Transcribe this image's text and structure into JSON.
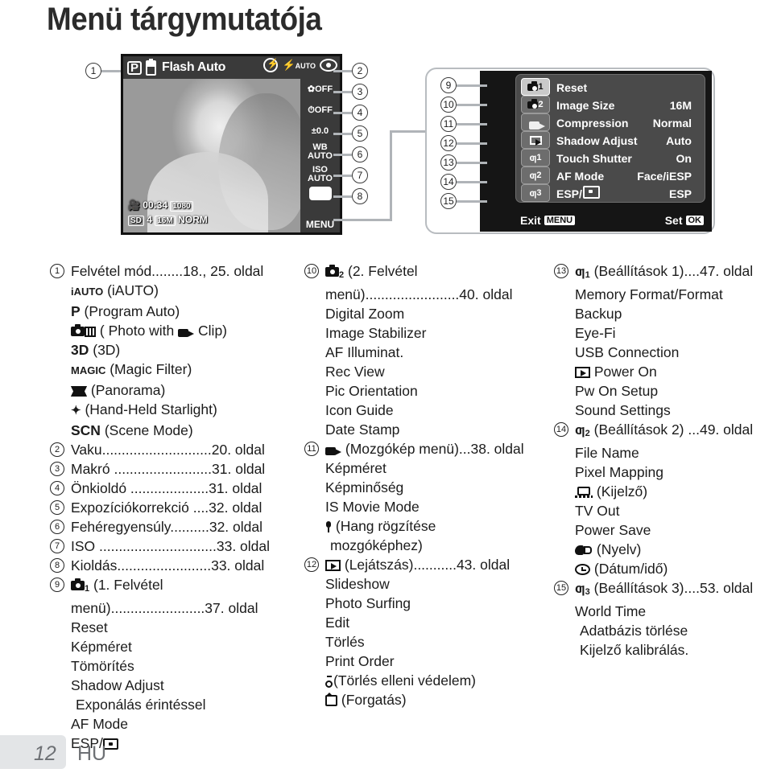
{
  "page": {
    "title": "Menü tárgymutatója",
    "number": "12",
    "language_code": "HU"
  },
  "lcd": {
    "mode_badge": "P",
    "battery_icon": "battery-icon",
    "top_title": "Flash Auto",
    "top_icons": [
      "flash-off-icon",
      "flash-auto-icon",
      "red-eye-icon"
    ],
    "strip": [
      {
        "label": "OFF",
        "icon": "macro-icon"
      },
      {
        "label": "OFF",
        "icon": "self-timer-icon"
      },
      {
        "label": "±0.0",
        "icon": "exposure-comp-icon"
      },
      {
        "label": "WB\nAUTO",
        "icon": "white-balance-icon"
      },
      {
        "label": "ISO\nAUTO",
        "icon": "iso-icon"
      },
      {
        "label": "",
        "icon": "drive-mode-icon"
      }
    ],
    "strip_wb_line1": "WB",
    "strip_wb_line2": "AUTO",
    "strip_iso_line1": "ISO",
    "strip_iso_line2": "AUTO",
    "strip_exp": "±0.0",
    "strip_macro_off": "OFF",
    "strip_timer_off": "OFF",
    "menu_button_label": "MENU",
    "status": {
      "movie_time": "00:34",
      "movie_res": "1080",
      "card": "SD",
      "shots": "4",
      "image_size": "16M",
      "quality": "NORM"
    }
  },
  "menu_screen": {
    "tabs": [
      "■₁",
      "■₂",
      "■",
      "▶",
      "ƒ₁",
      "ƒ₂",
      "ƒ₃"
    ],
    "tab_names": [
      "shooting-menu-1-tab",
      "shooting-menu-2-tab",
      "movie-menu-tab",
      "playback-menu-tab",
      "settings-1-tab",
      "settings-2-tab",
      "settings-3-tab"
    ],
    "rows": [
      {
        "label": "Reset",
        "value": ""
      },
      {
        "label": "Image Size",
        "value": "16M"
      },
      {
        "label": "Compression",
        "value": "Normal"
      },
      {
        "label": "Shadow Adjust",
        "value": "Auto"
      },
      {
        "label": "Touch Shutter",
        "value": "On"
      },
      {
        "label": "AF Mode",
        "value": "Face/iESP"
      },
      {
        "label": "ESP/",
        "value": "ESP",
        "has_spot_icon": true
      }
    ],
    "footer_exit": "Exit",
    "footer_exit_key": "MENU",
    "footer_set": "Set",
    "footer_set_key": "OK"
  },
  "callouts": {
    "left": [
      "1",
      "2",
      "3",
      "4",
      "5",
      "6",
      "7",
      "8"
    ],
    "right": [
      "9",
      "10",
      "11",
      "12",
      "13",
      "14",
      "15"
    ]
  },
  "columns": {
    "col1": [
      {
        "type": "entry",
        "num": "1",
        "text": "Felvétel mód........18., 25. oldal"
      },
      {
        "type": "sub",
        "bold_prefix": "iAUTO",
        "text": " (iAUTO)"
      },
      {
        "type": "sub",
        "bold_prefix": "P",
        "text": " (Program Auto)"
      },
      {
        "type": "sub_icon",
        "icon": "photo-with-clip-icon",
        "text": "( Photo with",
        "text2": "Clip)"
      },
      {
        "type": "sub",
        "bold_prefix": "3D",
        "text": " (3D)"
      },
      {
        "type": "sub",
        "bold_prefix": "MAGIC",
        "text": " (Magic Filter)"
      },
      {
        "type": "sub_icon",
        "icon": "panorama-icon",
        "text": "(Panorama)"
      },
      {
        "type": "sub_icon",
        "icon": "hand-held-starlight-icon",
        "text": "(Hand-Held Starlight)"
      },
      {
        "type": "sub",
        "bold_prefix": "SCN",
        "text": " (Scene Mode)"
      },
      {
        "type": "entry",
        "num": "2",
        "text": "Vaku............................20. oldal"
      },
      {
        "type": "entry",
        "num": "3",
        "text": "Makró .........................31. oldal"
      },
      {
        "type": "entry",
        "num": "4",
        "text": "Önkioldó ....................31. oldal"
      },
      {
        "type": "entry",
        "num": "5",
        "text": "Expozíciókorrekció ....32. oldal"
      },
      {
        "type": "entry",
        "num": "6",
        "text": "Fehéregyensúly..........32. oldal"
      },
      {
        "type": "entry",
        "num": "7",
        "text": "ISO ..............................33. oldal"
      },
      {
        "type": "entry",
        "num": "8",
        "text": "Kioldás........................33. oldal"
      },
      {
        "type": "entry_icon",
        "num": "9",
        "icon": "shooting-menu-1-icon",
        "text": "(1. Felvétel"
      },
      {
        "type": "cont",
        "text": "menü)........................37. oldal"
      },
      {
        "type": "cont",
        "text": "Reset"
      },
      {
        "type": "cont",
        "text": "Képméret"
      },
      {
        "type": "cont",
        "text": "Tömörítés"
      },
      {
        "type": "cont",
        "text": "Shadow Adjust"
      },
      {
        "type": "cont_indent",
        "text": "Exponálás érintéssel"
      },
      {
        "type": "cont",
        "text": "AF Mode"
      },
      {
        "type": "cont_esp",
        "text": "ESP/"
      }
    ],
    "col2": [
      {
        "type": "entry_icon",
        "num": "10",
        "icon": "shooting-menu-2-icon",
        "text": "(2. Felvétel"
      },
      {
        "type": "cont",
        "text": "menü)........................40. oldal"
      },
      {
        "type": "cont",
        "text": "Digital Zoom"
      },
      {
        "type": "cont",
        "text": "Image Stabilizer"
      },
      {
        "type": "cont",
        "text": "AF Illuminat."
      },
      {
        "type": "cont",
        "text": "Rec View"
      },
      {
        "type": "cont",
        "text": "Pic Orientation"
      },
      {
        "type": "cont",
        "text": "Icon Guide"
      },
      {
        "type": "cont",
        "text": "Date Stamp"
      },
      {
        "type": "entry_icon",
        "num": "11",
        "icon": "movie-menu-icon",
        "text": "(Mozgókép menü)...38. oldal"
      },
      {
        "type": "cont",
        "text": "Képméret"
      },
      {
        "type": "cont",
        "text": "Képminőség"
      },
      {
        "type": "cont",
        "text": "IS Movie Mode"
      },
      {
        "type": "cont_icon",
        "icon": "microphone-icon",
        "text": "(Hang rögzítése"
      },
      {
        "type": "cont_indent",
        "text": "mozgóképhez)"
      },
      {
        "type": "entry_icon",
        "num": "12",
        "icon": "playback-icon",
        "text": "(Lejátszás)...........43. oldal"
      },
      {
        "type": "cont",
        "text": "Slideshow"
      },
      {
        "type": "cont",
        "text": "Photo Surfing"
      },
      {
        "type": "cont",
        "text": "Edit"
      },
      {
        "type": "cont",
        "text": "Törlés"
      },
      {
        "type": "cont",
        "text": "Print Order"
      },
      {
        "type": "cont_icon",
        "icon": "protect-icon",
        "text": "(Törlés elleni védelem)"
      },
      {
        "type": "cont_icon",
        "icon": "rotate-icon",
        "text": "(Forgatás)"
      }
    ],
    "col3": [
      {
        "type": "entry_icon",
        "num": "13",
        "icon": "settings-1-icon",
        "text": "(Beállítások 1)....47. oldal"
      },
      {
        "type": "cont",
        "text": "Memory Format/Format"
      },
      {
        "type": "cont",
        "text": "Backup"
      },
      {
        "type": "cont",
        "text": "Eye-Fi"
      },
      {
        "type": "cont",
        "text": "USB Connection"
      },
      {
        "type": "cont_icon",
        "icon": "playback-icon",
        "text": "Power On"
      },
      {
        "type": "cont",
        "text": "Pw On Setup"
      },
      {
        "type": "cont",
        "text": "Sound Settings"
      },
      {
        "type": "entry_icon",
        "num": "14",
        "icon": "settings-2-icon",
        "text": "(Beállítások 2) ...49. oldal"
      },
      {
        "type": "cont",
        "text": "File Name"
      },
      {
        "type": "cont",
        "text": "Pixel Mapping"
      },
      {
        "type": "cont_icon",
        "icon": "monitor-icon",
        "text": "(Kijelző)"
      },
      {
        "type": "cont",
        "text": "TV Out"
      },
      {
        "type": "cont",
        "text": "Power Save"
      },
      {
        "type": "cont_icon",
        "icon": "language-icon",
        "text": "(Nyelv)"
      },
      {
        "type": "cont_icon",
        "icon": "clock-icon",
        "text": "(Dátum/idő)"
      },
      {
        "type": "entry_icon",
        "num": "15",
        "icon": "settings-3-icon",
        "text": "(Beállítások 3)....53. oldal"
      },
      {
        "type": "cont",
        "text": "World Time"
      },
      {
        "type": "cont_indent",
        "text": "Adatbázis törlése"
      },
      {
        "type": "cont_indent",
        "text": "Kijelző kalibrálás."
      }
    ]
  }
}
